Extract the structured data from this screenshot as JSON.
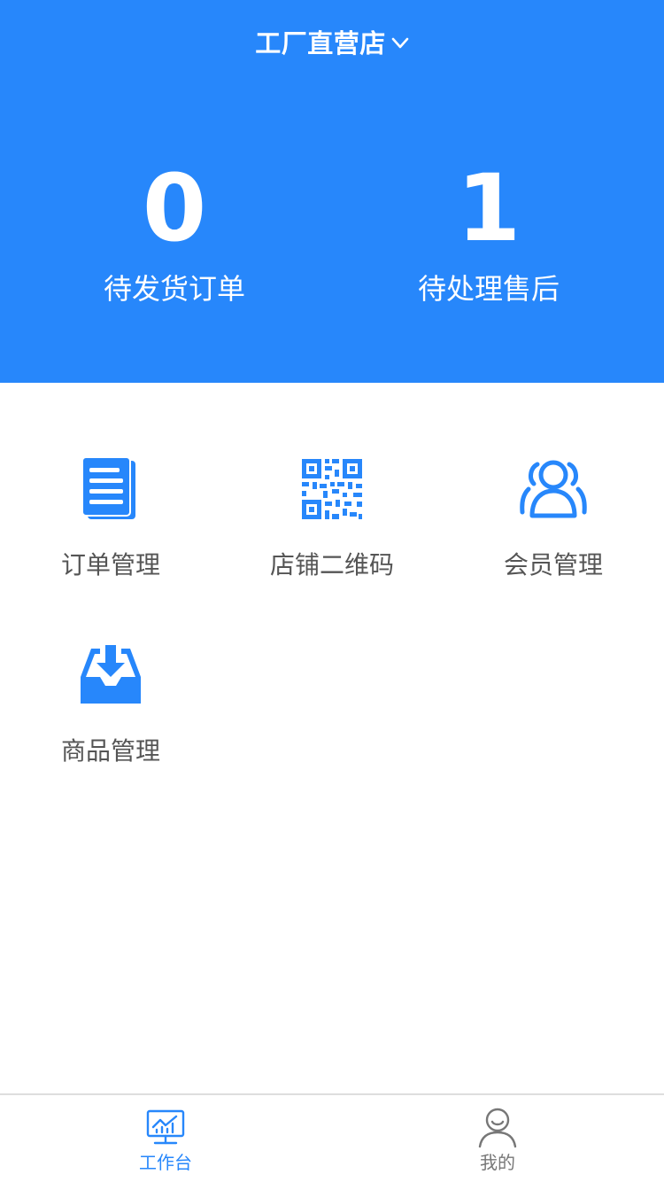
{
  "header": {
    "store_name": "工厂直营店",
    "bg_color": "#2787fb",
    "stats": [
      {
        "value": "0",
        "label": "待发货订单"
      },
      {
        "value": "1",
        "label": "待处理售后"
      }
    ]
  },
  "grid": {
    "items": [
      {
        "label": "订单管理",
        "icon": "document-list-icon"
      },
      {
        "label": "店铺二维码",
        "icon": "qr-code-icon"
      },
      {
        "label": "会员管理",
        "icon": "users-icon"
      },
      {
        "label": "商品管理",
        "icon": "inbox-download-icon"
      }
    ]
  },
  "tabbar": {
    "tabs": [
      {
        "label": "工作台",
        "icon": "dashboard-chart-icon",
        "active": true
      },
      {
        "label": "我的",
        "icon": "user-profile-icon",
        "active": false
      }
    ],
    "active_color": "#2787fb"
  }
}
